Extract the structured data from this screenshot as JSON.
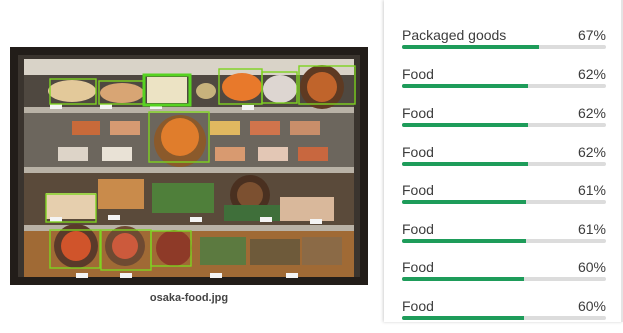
{
  "image": {
    "filename": "osaka-food.jpg"
  },
  "colors": {
    "accent": "#1e9c5a",
    "track": "#dcdcdc",
    "detection_box": "#7ed321",
    "detection_box_selected": "#57d321"
  },
  "labels": [
    {
      "name": "Packaged goods",
      "score": "67%",
      "value": 0.67
    },
    {
      "name": "Food",
      "score": "62%",
      "value": 0.62
    },
    {
      "name": "Food",
      "score": "62%",
      "value": 0.62
    },
    {
      "name": "Food",
      "score": "62%",
      "value": 0.62
    },
    {
      "name": "Food",
      "score": "61%",
      "value": 0.61
    },
    {
      "name": "Food",
      "score": "61%",
      "value": 0.61
    },
    {
      "name": "Food",
      "score": "60%",
      "value": 0.6
    },
    {
      "name": "Food",
      "score": "60%",
      "value": 0.6
    }
  ]
}
